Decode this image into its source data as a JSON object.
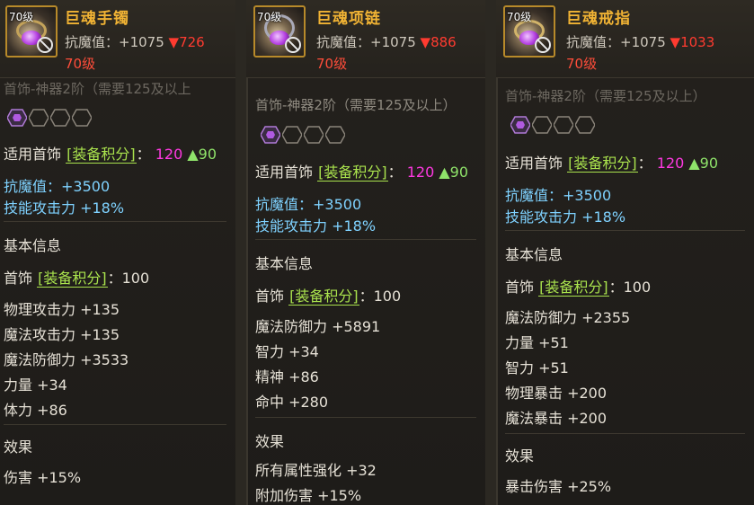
{
  "items": [
    {
      "name": "巨魂手镯",
      "level_badge": "70级",
      "resist_label": "抗魔值：",
      "resist_value": "+1075",
      "resist_diff": "▼726",
      "level_req": "70级",
      "req_text": "首饰-神器2阶（需要125及以上",
      "suit_label": "适用首饰",
      "bracket": "[装备积分]",
      "colon": "：",
      "score": "120",
      "score_up": "▲90",
      "bonus": [
        "抗魔值：+3500",
        "技能攻击力 +18%"
      ],
      "basic_title": "基本信息",
      "basic_score_label": "首饰",
      "basic_score_value": "100",
      "stats": [
        "物理攻击力 +135",
        "魔法攻击力 +135",
        "魔法防御力 +3533",
        "力量 +34",
        "体力 +86"
      ],
      "effect_title": "效果",
      "effects": [
        "伤害 +15%"
      ]
    },
    {
      "name": "巨魂项链",
      "level_badge": "70级",
      "resist_label": "抗魔值：",
      "resist_value": "+1075",
      "resist_diff": "▼886",
      "level_req": "70级",
      "req_text": "首饰-神器2阶（需要125及以上）",
      "suit_label": "适用首饰",
      "bracket": "[装备积分]",
      "colon": "：",
      "score": "120",
      "score_up": "▲90",
      "bonus": [
        "抗魔值：+3500",
        "技能攻击力 +18%"
      ],
      "basic_title": "基本信息",
      "basic_score_label": "首饰",
      "basic_score_value": "100",
      "stats": [
        "魔法防御力 +5891",
        "智力 +34",
        "精神 +86",
        "命中 +280"
      ],
      "effect_title": "效果",
      "effects": [
        "所有属性强化 +32",
        "附加伤害 +15%"
      ]
    },
    {
      "name": "巨魂戒指",
      "level_badge": "70级",
      "resist_label": "抗魔值：",
      "resist_value": "+1075",
      "resist_diff": "▼1033",
      "level_req": "70级",
      "req_text": "首饰-神器2阶（需要125及以上）",
      "suit_label": "适用首饰",
      "bracket": "[装备积分]",
      "colon": "：",
      "score": "120",
      "score_up": "▲90",
      "bonus": [
        "抗魔值：+3500",
        "技能攻击力 +18%"
      ],
      "basic_title": "基本信息",
      "basic_score_label": "首饰",
      "basic_score_value": "100",
      "stats": [
        "魔法防御力 +2355",
        "力量 +51",
        "智力 +51",
        "物理暴击 +200",
        "魔法暴击 +200"
      ],
      "effect_title": "效果",
      "effects": [
        "暴击伤害 +25%"
      ]
    }
  ]
}
